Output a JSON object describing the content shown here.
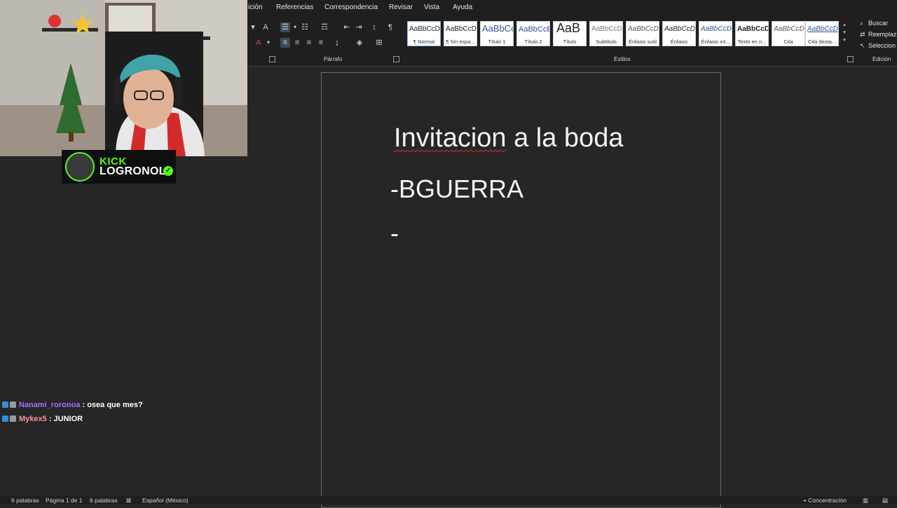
{
  "menu": {
    "items": [
      "ición",
      "Referencias",
      "Correspondencia",
      "Revisar",
      "Vista",
      "Ayuda"
    ]
  },
  "ribbon": {
    "groups": {
      "paragraph": "Párrafo",
      "styles": "Estilos",
      "editing": "Edición"
    },
    "styles": [
      {
        "sample": "AaBbCcDc",
        "name": "¶ Normal"
      },
      {
        "sample": "AaBbCcDc",
        "name": "¶ Sin espa..."
      },
      {
        "sample": "AaBbCc",
        "name": "Título 1"
      },
      {
        "sample": "AaBbCcE",
        "name": "Título 2"
      },
      {
        "sample": "AaB",
        "name": "Título"
      },
      {
        "sample": "AaBbCcD",
        "name": "Subtítulo"
      },
      {
        "sample": "AaBbCcDc",
        "name": "Énfasis sutil"
      },
      {
        "sample": "AaBbCcDc",
        "name": "Énfasis"
      },
      {
        "sample": "AaBbCcDc",
        "name": "Énfasis int..."
      },
      {
        "sample": "AaBbCcDc",
        "name": "Texto en n..."
      },
      {
        "sample": "AaBbCcDc",
        "name": "Cita"
      },
      {
        "sample": "AaBbCcDc",
        "name": "Cita desta..."
      }
    ],
    "editing": {
      "find": "Buscar",
      "replace": "Reemplaz",
      "select": "Seleccion"
    }
  },
  "document": {
    "title_word1": "Invitacion",
    "title_rest": " a la boda",
    "line1": "-BGUERRA",
    "line2": "-"
  },
  "overlay": {
    "kick_brand": "KICK",
    "kick_user": "LOGRONOL",
    "chat": [
      {
        "user": "Nanami_roronoa",
        "sep": " : ",
        "text": "osea que mes?",
        "color": "#b36bff"
      },
      {
        "user": "Mykex5",
        "sep": " : ",
        "text": "JUNIOR",
        "color": "#ff8fa3"
      }
    ]
  },
  "status": {
    "words_a": "6 palabras",
    "page": "Página 1 de 1",
    "words_b": "6 palabras",
    "language": "Español (México)",
    "focus": "Concentración"
  },
  "colors": {
    "kick_green": "#53fc18",
    "spell_red": "#d13438",
    "ribbon_bg": "#1f1f1f",
    "doc_bg": "#262626"
  }
}
